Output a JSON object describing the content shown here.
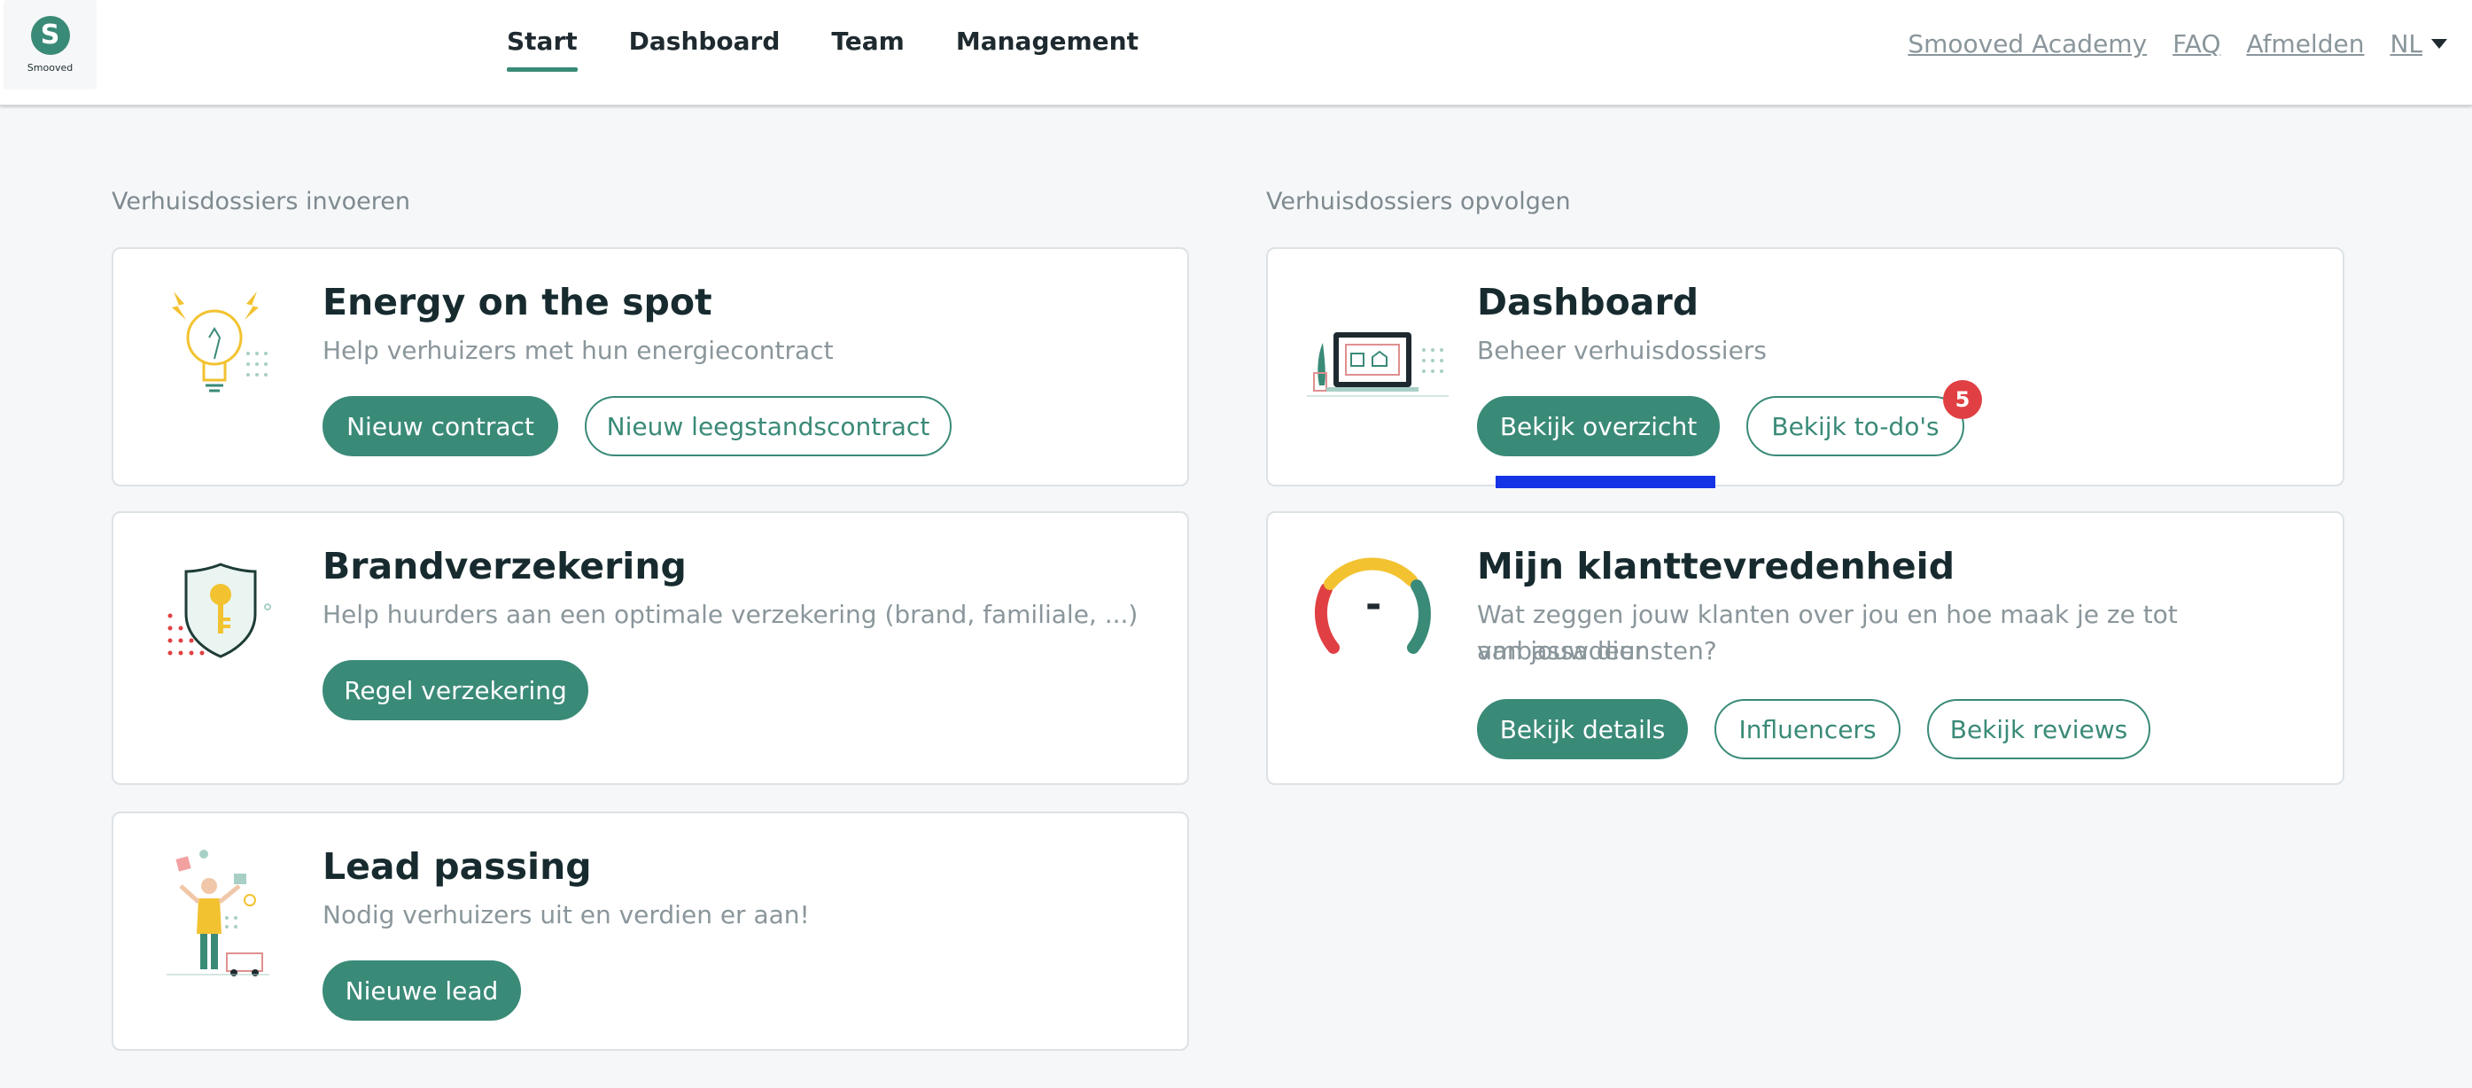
{
  "header": {
    "logo_text": "Smooved",
    "nav": [
      {
        "label": "Start",
        "active": true
      },
      {
        "label": "Dashboard"
      },
      {
        "label": "Team"
      },
      {
        "label": "Management"
      }
    ],
    "util_links": [
      "Smooved Academy",
      "FAQ",
      "Afmelden"
    ],
    "language": "NL"
  },
  "left_section": {
    "title": "Verhuisdossiers invoeren",
    "cards": [
      {
        "title": "Energy on the spot",
        "subtitle": "Help verhuizers met hun energiecontract",
        "icon": "lightbulb-icon",
        "buttons": [
          "Nieuw contract",
          "Nieuw leegstandscontract"
        ]
      },
      {
        "title": "Brandverzekering",
        "subtitle": "Help huurders aan een optimale verzekering (brand, familiale, ...)",
        "icon": "shield-key-icon",
        "buttons": [
          "Regel verzekering"
        ]
      },
      {
        "title": "Lead passing",
        "subtitle": "Nodig verhuizers uit en verdien er aan!",
        "icon": "juggling-person-icon",
        "buttons": [
          "Nieuwe lead"
        ]
      }
    ]
  },
  "right_section": {
    "title": "Verhuisdossiers opvolgen",
    "cards": [
      {
        "title": "Dashboard",
        "subtitle": "Beheer verhuisdossiers",
        "icon": "laptop-icon",
        "buttons": [
          "Bekijk overzicht",
          "Bekijk to-do's"
        ],
        "todo_badge": "5"
      },
      {
        "title": "Mijn klanttevredenheid",
        "subtitle_line1": "Wat zeggen jouw klanten over jou en hoe maak je ze tot ambassadeur",
        "subtitle_line2": "van jouw diensten?",
        "icon": "gauge-icon",
        "gauge_value": "-",
        "buttons": [
          "Bekijk details",
          "Influencers",
          "Bekijk reviews"
        ]
      }
    ]
  },
  "colors": {
    "brand": "#3a8a78",
    "badge": "#e04043",
    "marker": "#1434e6",
    "background": "#f5f7f9"
  }
}
